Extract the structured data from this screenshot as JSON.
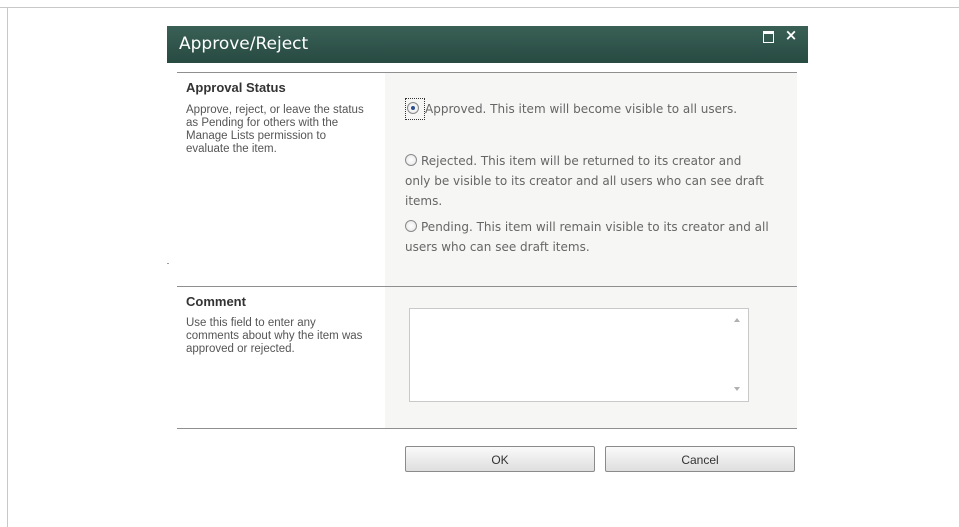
{
  "dialog": {
    "title": "Approve/Reject",
    "controls": {
      "maximize_icon": "maximize-icon",
      "close_icon": "close-icon",
      "close_glyph": "×"
    }
  },
  "approval": {
    "heading": "Approval Status",
    "description": "Approve, reject, or leave the status as Pending for others with the Manage Lists permission to evaluate the item.",
    "selected": "approved",
    "options": [
      {
        "id": "approved",
        "label": "Approved. This item will become visible to all users."
      },
      {
        "id": "rejected",
        "label": "Rejected. This item will be returned to its creator and only be visible to its creator and all users who can see draft items."
      },
      {
        "id": "pending",
        "label": "Pending. This item will remain visible to its creator and all users who can see draft items."
      }
    ]
  },
  "comment": {
    "heading": "Comment",
    "description": "Use this field to enter any comments about why the item was approved or rejected.",
    "value": ""
  },
  "buttons": {
    "ok": "OK",
    "cancel": "Cancel"
  },
  "colors": {
    "titlebar": "#2f5249",
    "title_text": "#ffffff",
    "section_bg": "#f6f6f4",
    "option_text": "#666666"
  }
}
